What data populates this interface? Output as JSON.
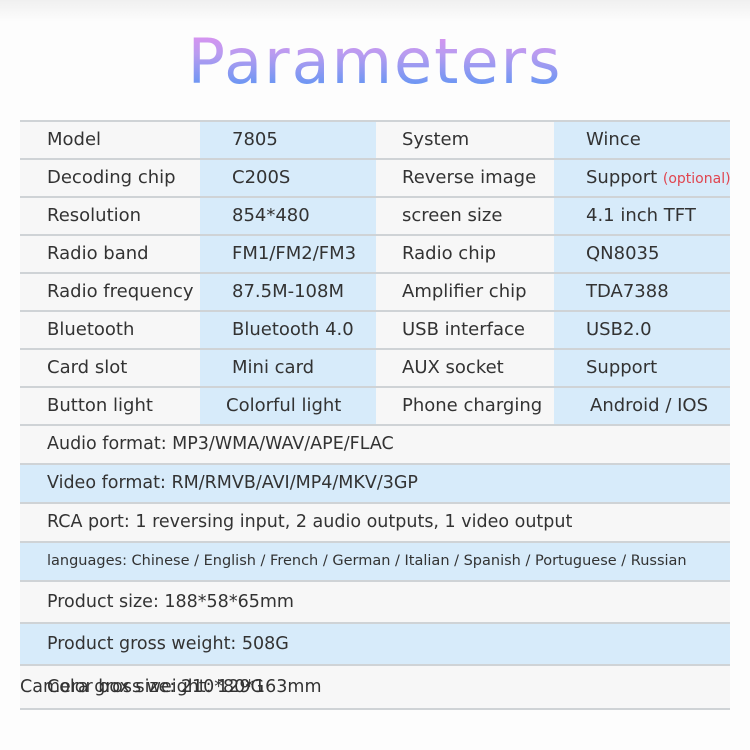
{
  "title": "Parameters",
  "specs": [
    {
      "label": "Model",
      "value": "7805",
      "label2": "System",
      "value2": "Wince"
    },
    {
      "label": "Decoding chip",
      "value": "C200S",
      "label2": "Reverse image",
      "value2": "Support",
      "value2_note": "(optional)"
    },
    {
      "label": "Resolution",
      "value": "854*480",
      "label2": "screen size",
      "value2": "4.1 inch TFT"
    },
    {
      "label": "Radio band",
      "value": "FM1/FM2/FM3",
      "label2": "Radio chip",
      "value2": "QN8035"
    },
    {
      "label": "Radio frequency",
      "value": "87.5M-108M",
      "label2": "Amplifier chip",
      "value2": "TDA7388"
    },
    {
      "label": "Bluetooth",
      "value": "Bluetooth 4.0",
      "label2": "USB interface",
      "value2": "USB2.0"
    },
    {
      "label": "Card slot",
      "value": "Mini card",
      "label2": "AUX socket",
      "value2": "Support"
    },
    {
      "label": "Button light",
      "value": "Colorful light",
      "label2": "Phone charging",
      "value2": "Android / IOS"
    }
  ],
  "details": {
    "audio_format": "Audio format: MP3/WMA/WAV/APE/FLAC",
    "video_format": "Video format: RM/RMVB/AVI/MP4/MKV/3GP",
    "rca_port": "RCA port: 1 reversing input, 2 audio outputs, 1 video output",
    "languages": "languages: Chinese / English / French / German / Italian / Spanish / Portuguese / Russian",
    "product_size": "Product size: 188*58*65mm",
    "gross_weight": "Product gross weight: 508G",
    "color_box_size": "Color box size: 210*80*163mm",
    "camera_weight": "Camera gross weight: 129G"
  },
  "colors": {
    "title_gradient_top": "#ef8cf0",
    "title_gradient_bottom": "#3f93f5",
    "highlight_blue": "#d7ebfa",
    "optional_red": "#e0454f"
  }
}
